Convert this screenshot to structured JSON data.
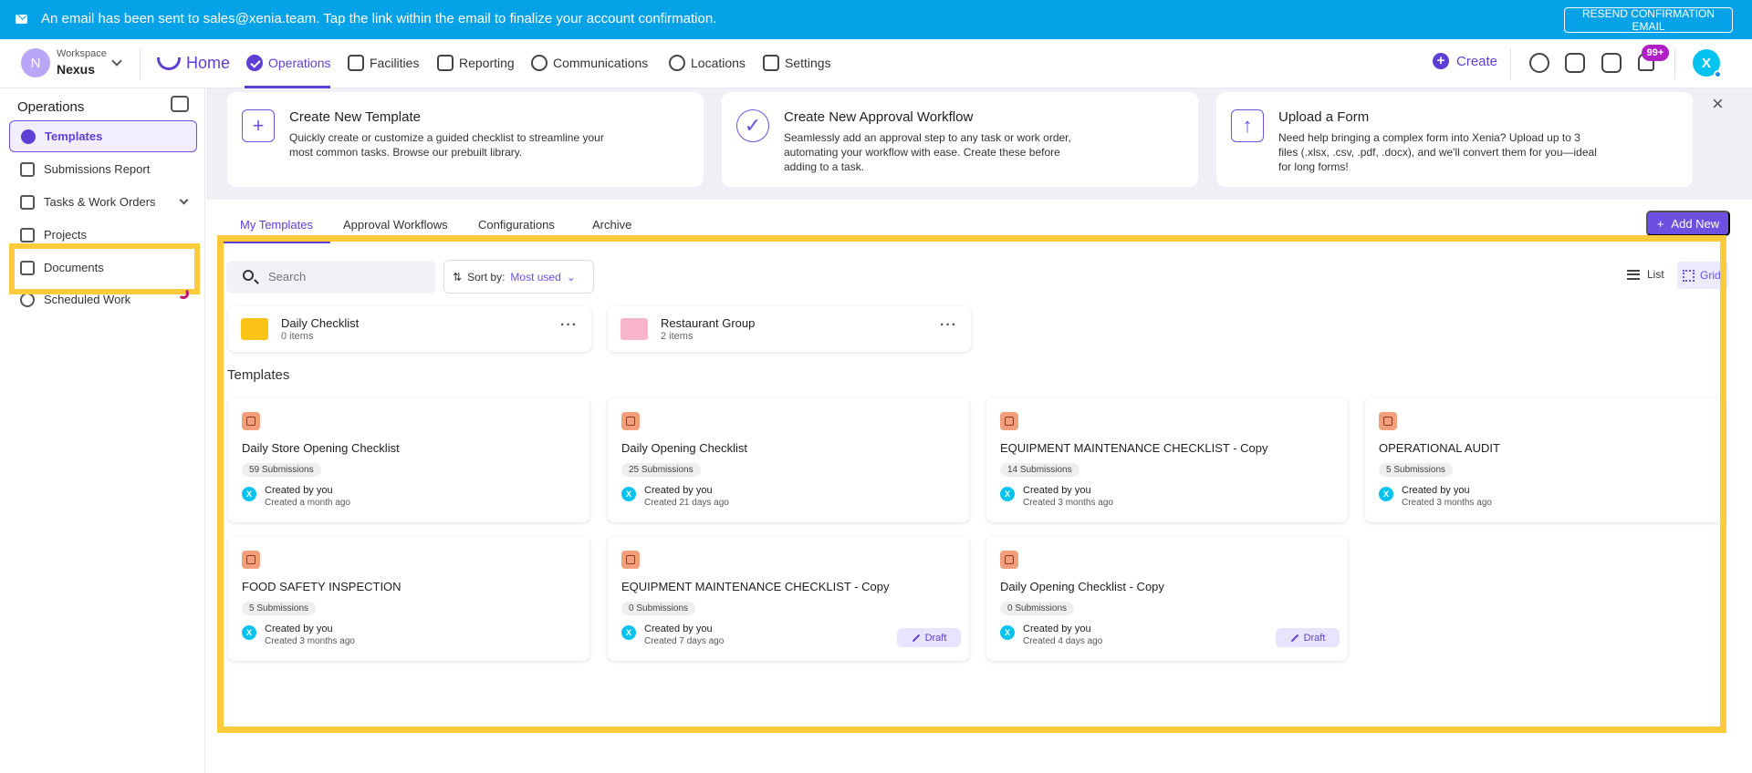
{
  "banner": {
    "message": "An email has been sent to sales@xenia.team. Tap the link within the email to finalize your account confirmation.",
    "resend_label": "RESEND CONFIRMATION EMAIL"
  },
  "topnav": {
    "workspace_initial": "N",
    "workspace_label": "Workspace",
    "workspace_name": "Nexus",
    "home_label": "Home",
    "items": [
      {
        "label": "Operations",
        "icon": "check-circle-icon",
        "active": true
      },
      {
        "label": "Facilities",
        "icon": "tools-icon"
      },
      {
        "label": "Reporting",
        "icon": "chart-board-icon"
      },
      {
        "label": "Communications",
        "icon": "chat-icon"
      },
      {
        "label": "Locations",
        "icon": "pin-icon"
      },
      {
        "label": "Settings",
        "icon": "sliders-icon"
      }
    ],
    "create_label": "Create",
    "notif_badge": "99+",
    "user_initial": "X"
  },
  "sidebar": {
    "title": "Operations",
    "items": [
      {
        "label": "Templates",
        "icon": "check-circle-icon",
        "active": true
      },
      {
        "label": "Submissions Report",
        "icon": "report-icon"
      },
      {
        "label": "Tasks & Work Orders",
        "icon": "document-icon"
      },
      {
        "label": "Projects",
        "icon": "projects-icon"
      },
      {
        "label": "Documents",
        "icon": "layers-icon"
      },
      {
        "label": "Scheduled Work",
        "icon": "refresh-icon"
      }
    ]
  },
  "promos": [
    {
      "icon": "+",
      "title": "Create New Template",
      "desc": "Quickly create or customize a guided checklist to streamline your most common tasks. Browse our prebuilt library."
    },
    {
      "icon": "✓",
      "title": "Create New Approval Workflow",
      "desc": "Seamlessly add an approval step to any task or work order, automating your workflow with ease. Create these before adding to a task."
    },
    {
      "icon": "↑",
      "title": "Upload a Form",
      "desc": "Need help bringing a complex form into Xenia? Upload up to 3 files (.xlsx, .csv, .pdf, .docx), and we'll convert them for you—ideal for long forms!"
    }
  ],
  "tabs": [
    "My Templates",
    "Approval Workflows",
    "Configurations",
    "Archive"
  ],
  "add_new_label": "Add New",
  "toolbar": {
    "search_placeholder": "Search",
    "sort_prefix": "Sort by:",
    "sort_value": "Most used",
    "list_label": "List",
    "grid_label": "Grid"
  },
  "folders": [
    {
      "name": "Daily Checklist",
      "count": "0 items",
      "color": "#fcc419"
    },
    {
      "name": "Restaurant Group",
      "count": "2 items",
      "color": "#f8b4cb"
    }
  ],
  "templates_title": "Templates",
  "templates": [
    {
      "title": "Daily Store Opening Checklist",
      "submissions": "59 Submissions",
      "by": "Created by you",
      "when": "Created a month ago",
      "draft": false
    },
    {
      "title": "Daily Opening Checklist",
      "submissions": "25 Submissions",
      "by": "Created by you",
      "when": "Created 21 days ago",
      "draft": false
    },
    {
      "title": "EQUIPMENT MAINTENANCE CHECKLIST - Copy",
      "submissions": "14 Submissions",
      "by": "Created by you",
      "when": "Created 3 months ago",
      "draft": false
    },
    {
      "title": "OPERATIONAL AUDIT",
      "submissions": "5 Submissions",
      "by": "Created by you",
      "when": "Created 3 months ago",
      "draft": false
    },
    {
      "title": "FOOD SAFETY INSPECTION",
      "submissions": "5 Submissions",
      "by": "Created by you",
      "when": "Created 3 months ago",
      "draft": false
    },
    {
      "title": "EQUIPMENT MAINTENANCE CHECKLIST - Copy",
      "submissions": "0 Submissions",
      "by": "Created by you",
      "when": "Created 7 days ago",
      "draft": true,
      "draft_label": "Draft"
    },
    {
      "title": "Daily Opening Checklist - Copy",
      "submissions": "0 Submissions",
      "by": "Created by you",
      "when": "Created 4 days ago",
      "draft": true,
      "draft_label": "Draft"
    }
  ],
  "colors": {
    "accent": "#6d50e0",
    "banner": "#05a2e8",
    "highlight": "#fccb3c"
  }
}
